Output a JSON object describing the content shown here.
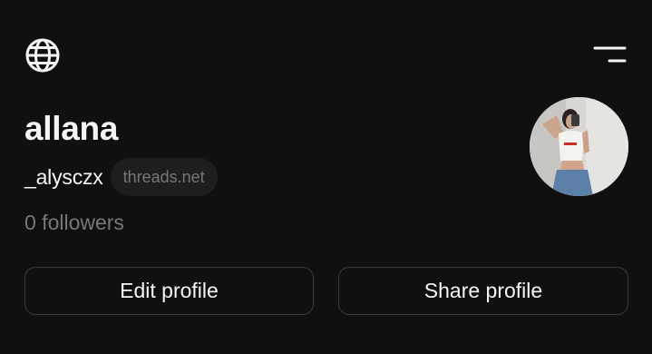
{
  "header": {
    "language_icon": "globe-icon",
    "menu_icon": "menu-icon"
  },
  "profile": {
    "display_name": "allana",
    "username": "_alysczx",
    "domain_badge": "threads.net",
    "followers_text": "0 followers",
    "avatar": "profile-photo"
  },
  "actions": {
    "edit_label": "Edit profile",
    "share_label": "Share profile"
  },
  "colors": {
    "background": "#101010",
    "primary_text": "#f3f5f7",
    "secondary_text": "#777777",
    "badge_bg": "#1e1e1e",
    "button_border": "#3a3a3a"
  }
}
